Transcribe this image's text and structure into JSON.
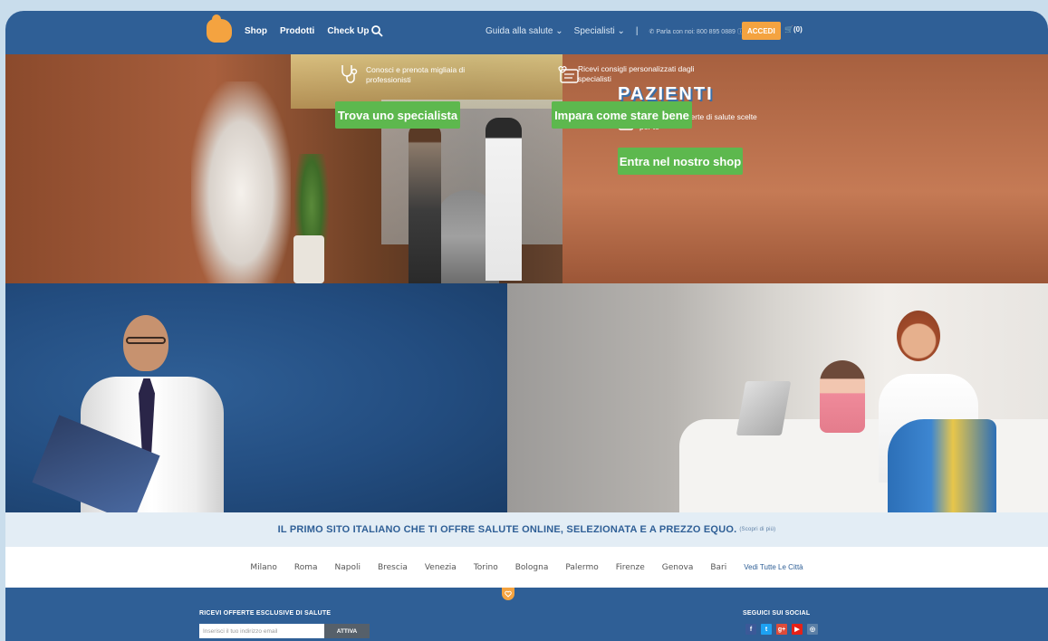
{
  "nav": {
    "left": [
      "Shop",
      "Prodotti",
      "Check Up"
    ],
    "guida": "Guida alla salute",
    "specialisti": "Specialisti",
    "separator": "|",
    "phone": "Parla con noi: 800 895 0889",
    "accedi": "ACCEDI",
    "cart": "(0)"
  },
  "hero": {
    "brand": "PAZIENTI",
    "text": "Centinaia di offerte di salute scelte per te",
    "button": "Entra nel nostro shop"
  },
  "specialist": {
    "text": "Conosci e prenota migliaia di professionisti",
    "button": "Trova uno specialista"
  },
  "care": {
    "text": "Ricevi consigli personalizzati dagli specialisti",
    "button": "Impara come stare bene"
  },
  "tagline": {
    "main": "IL PRIMO SITO ITALIANO CHE TI OFFRE SALUTE ONLINE, SELEZIONATA E A PREZZO EQUO.",
    "more": "(Scopri di più)"
  },
  "cities": [
    "Milano",
    "Roma",
    "Napoli",
    "Brescia",
    "Venezia",
    "Torino",
    "Bologna",
    "Palermo",
    "Firenze",
    "Genova",
    "Bari"
  ],
  "cities_all": "Vedi Tutte Le Città",
  "footer": {
    "newsletter_title": "RICEVI OFFERTE ESCLUSIVE DI SALUTE",
    "email_placeholder": "Inserisci il tuo indirizzo email",
    "subscribe": "ATTIVA",
    "social_title": "SEGUICI SUI SOCIAL",
    "social": [
      {
        "icon": "facebook-icon",
        "glyph": "f",
        "color": "#3b5998"
      },
      {
        "icon": "twitter-icon",
        "glyph": "t",
        "color": "#1da1f2"
      },
      {
        "icon": "google-plus-icon",
        "glyph": "g+",
        "color": "#dd4b39"
      },
      {
        "icon": "youtube-icon",
        "glyph": "▶",
        "color": "#e62117"
      },
      {
        "icon": "instagram-icon",
        "glyph": "◎",
        "color": "#5b7fa6"
      }
    ]
  },
  "colors": {
    "brand_blue": "#2f5f96",
    "accent_orange": "#f4a340",
    "cta_green": "#5db84e"
  }
}
